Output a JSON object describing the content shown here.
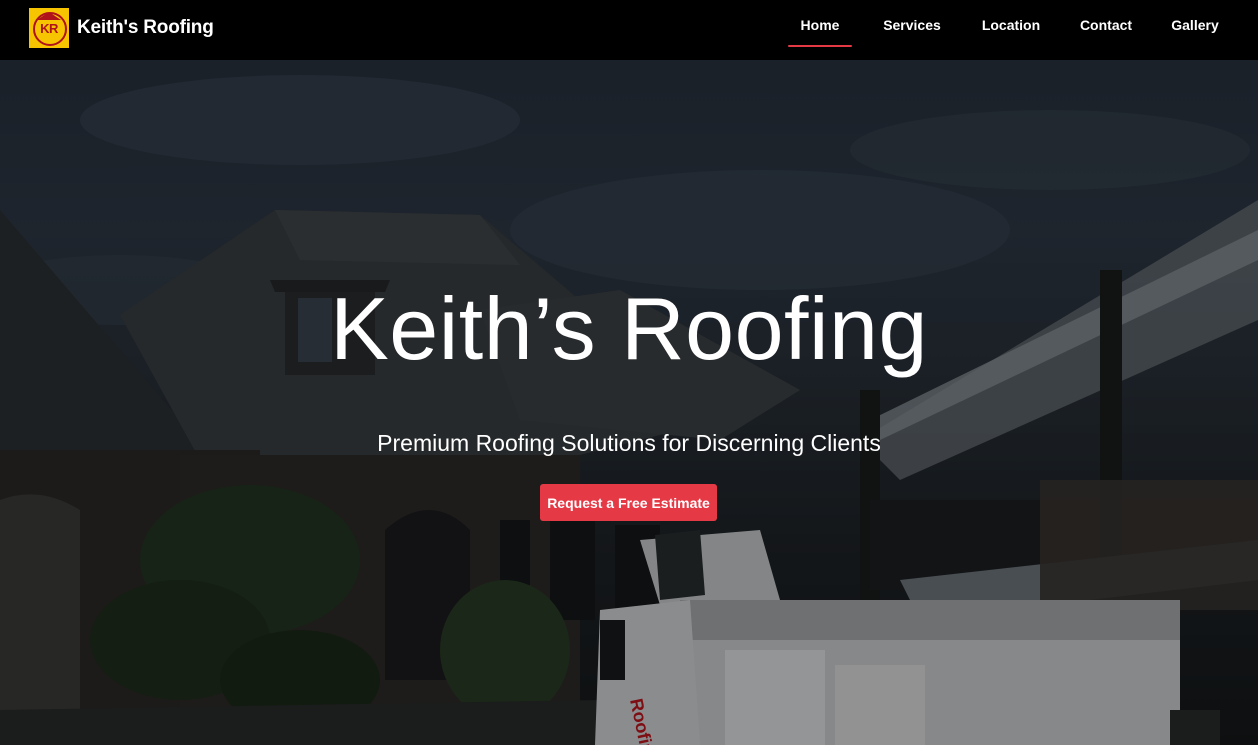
{
  "brand": {
    "logo_text": "KR",
    "name": "Keith's Roofing"
  },
  "nav": {
    "items": [
      {
        "label": "Home",
        "active": true
      },
      {
        "label": "Services",
        "active": false
      },
      {
        "label": "Location",
        "active": false
      },
      {
        "label": "Contact",
        "active": false
      },
      {
        "label": "Gallery",
        "active": false
      }
    ]
  },
  "hero": {
    "title": "Keith’s Roofing",
    "subtitle": "Premium Roofing Solutions for Discerning Clients",
    "cta_label": "Request a Free Estimate",
    "truck_text": "Roofing"
  },
  "colors": {
    "navbar": "#000000",
    "accent": "#e63946",
    "logo_bg": "#f6c400",
    "logo_mark": "#b0121b"
  }
}
